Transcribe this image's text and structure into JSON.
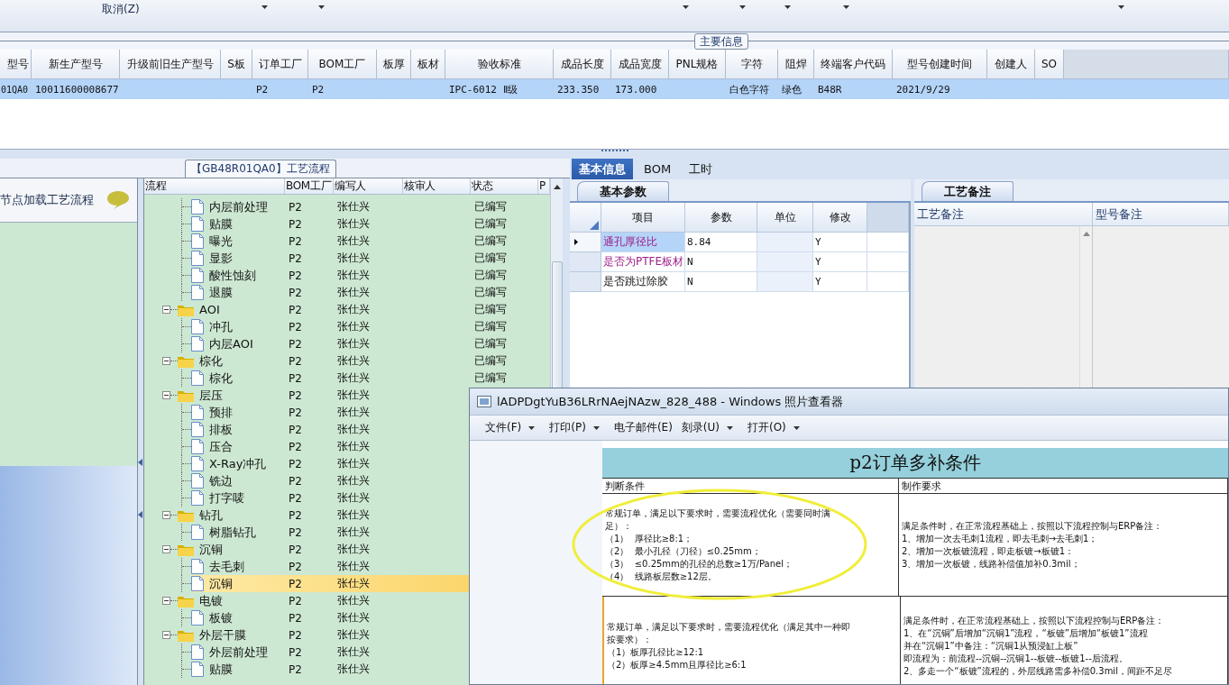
{
  "toolbar": {
    "items": [
      {
        "label": "取消(Z)"
      }
    ]
  },
  "main_info": {
    "legend": "主要信息",
    "columns": [
      "型号",
      "新生产型号",
      "升级前旧生产型号",
      "S板",
      "订单工厂",
      "BOM工厂",
      "板厚",
      "板材",
      "验收标准",
      "成品长度",
      "成品宽度",
      "PNL规格",
      "字符",
      "阻焊",
      "终端客户代码",
      "型号创建时间",
      "创建人",
      "SO"
    ],
    "rows": [
      {
        "selected": true,
        "cells": [
          "01QA0",
          "10011600008677",
          null,
          null,
          "P2",
          "P2",
          null,
          null,
          "IPC-6012 Ⅱ级",
          "233.350",
          "173.000",
          null,
          "白色字符",
          "绿色",
          "B48R",
          "2021/9/29",
          null,
          null
        ]
      }
    ]
  },
  "process_flow": {
    "legend": "【GB48R01QA0】工艺流程",
    "hint": "节点加载工艺流程",
    "columns": [
      "流程",
      "BOM工厂",
      "编写人",
      "核审人",
      "状态",
      "P"
    ],
    "tree": [
      {
        "children": [
          {
            "label": "内层前处理",
            "bom": "P2",
            "writer": "张仕兴",
            "status": "已编写",
            "selected": false
          },
          {
            "label": "贴膜",
            "bom": "P2",
            "writer": "张仕兴",
            "status": "已编写",
            "selected": false
          },
          {
            "label": "曝光",
            "bom": "P2",
            "writer": "张仕兴",
            "status": "已编写",
            "selected": false
          },
          {
            "label": "显影",
            "bom": "P2",
            "writer": "张仕兴",
            "status": "已编写",
            "selected": false
          },
          {
            "label": "酸性蚀刻",
            "bom": "P2",
            "writer": "张仕兴",
            "status": "已编写",
            "selected": false
          },
          {
            "label": "退膜",
            "bom": "P2",
            "writer": "张仕兴",
            "status": "已编写",
            "selected": false
          }
        ]
      },
      {
        "label": "AOI",
        "bom": "P2",
        "writer": "张仕兴",
        "status": "已编写",
        "selected": false,
        "expanded": true,
        "children": [
          {
            "label": "冲孔",
            "bom": "P2",
            "writer": "张仕兴",
            "status": "已编写",
            "selected": false
          },
          {
            "label": "内层AOI",
            "bom": "P2",
            "writer": "张仕兴",
            "status": "已编写",
            "selected": false
          }
        ]
      },
      {
        "label": "棕化",
        "bom": "P2",
        "writer": "张仕兴",
        "status": "已编写",
        "selected": false,
        "expanded": true,
        "children": [
          {
            "label": "棕化",
            "bom": "P2",
            "writer": "张仕兴",
            "status": "已编写",
            "selected": false
          }
        ]
      },
      {
        "label": "层压",
        "bom": "P2",
        "writer": "张仕兴",
        "selected": false,
        "expanded": true,
        "children": [
          {
            "label": "预排",
            "bom": "P2",
            "writer": "张仕兴",
            "selected": false
          },
          {
            "label": "排板",
            "bom": "P2",
            "writer": "张仕兴",
            "selected": false
          },
          {
            "label": "压合",
            "bom": "P2",
            "writer": "张仕兴",
            "selected": false
          },
          {
            "label": "X-Ray冲孔",
            "bom": "P2",
            "writer": "张仕兴",
            "selected": false
          },
          {
            "label": "铣边",
            "bom": "P2",
            "writer": "张仕兴",
            "selected": false
          },
          {
            "label": "打字唛",
            "bom": "P2",
            "writer": "张仕兴",
            "selected": false
          }
        ]
      },
      {
        "label": "钻孔",
        "bom": "P2",
        "writer": "张仕兴",
        "selected": false,
        "expanded": true,
        "children": [
          {
            "label": "树脂钻孔",
            "bom": "P2",
            "writer": "张仕兴",
            "selected": false
          }
        ]
      },
      {
        "label": "沉铜",
        "bom": "P2",
        "writer": "张仕兴",
        "selected": false,
        "expanded": true,
        "children": [
          {
            "label": "去毛刺",
            "bom": "P2",
            "writer": "张仕兴",
            "selected": false
          },
          {
            "label": "沉铜",
            "bom": "P2",
            "writer": "张仕兴",
            "selected": true
          }
        ]
      },
      {
        "label": "电镀",
        "bom": "P2",
        "writer": "张仕兴",
        "selected": false,
        "expanded": true,
        "children": [
          {
            "label": "板镀",
            "bom": "P2",
            "writer": "张仕兴",
            "selected": false
          }
        ]
      },
      {
        "label": "外层干膜",
        "bom": "P2",
        "writer": "张仕兴",
        "selected": false,
        "expanded": true,
        "children": [
          {
            "label": "外层前处理",
            "bom": "P2",
            "writer": "张仕兴",
            "selected": false
          },
          {
            "label": "贴膜",
            "bom": "P2",
            "writer": "张仕兴",
            "selected": false
          }
        ]
      }
    ]
  },
  "detail_tabs": [
    {
      "label": "基本信息",
      "selected": true
    },
    {
      "label": "BOM",
      "selected": false
    },
    {
      "label": "工时",
      "selected": false
    }
  ],
  "basic_params": {
    "tab": "基本参数",
    "columns": [
      "项目",
      "参数",
      "单位",
      "修改"
    ],
    "rows": [
      {
        "item": "通孔厚径比",
        "value": "8.84",
        "modify": "Y",
        "highlighted": true,
        "selected": true
      },
      {
        "item": "是否为PTFE板材",
        "value": "N",
        "modify": "Y",
        "highlighted": true,
        "selected": false
      },
      {
        "item": "是否跳过除胶",
        "value": "N",
        "modify": "Y",
        "highlighted": false,
        "selected": false
      }
    ]
  },
  "process_notes": {
    "tab": "工艺备注",
    "columns": [
      "工艺备注",
      "型号备注"
    ]
  },
  "photo_viewer": {
    "title": "lADPDgtYuB36LRrNAejNAzw_828_488 - Windows 照片查看器",
    "menu": [
      {
        "label": "文件(F)",
        "dropdown": true
      },
      {
        "label": "打印(P)",
        "dropdown": true
      },
      {
        "label": "电子邮件(E)",
        "dropdown": false
      },
      {
        "label": "刻录(U)",
        "dropdown": true
      },
      {
        "label": "打开(O)",
        "dropdown": true
      }
    ],
    "document": {
      "title": "p2订单多补条件",
      "columns": [
        "判断条件",
        "制作要求"
      ],
      "rows": [
        {
          "circled": true,
          "cells": [
            [
              "常规订单，满足以下要求时，需要流程优化（需要同时满",
              "足）：",
              "（1）  厚径比≥8:1；",
              "（2）  最小孔径（刀径）≤0.25mm；",
              "（3）  ≤0.25mm的孔径的总数≥1万/Panel；",
              "（4）  线路板层数≥12层。"
            ],
            [
              "满足条件时，在正常流程基础上，按照以下流程控制与ERP备注：",
              "1、增加一次去毛刺1流程，即去毛刺→去毛刺1；",
              "2、增加一次板镀流程，即走板镀→板镀1：",
              "3、增加一次板镀，线路补偿值加补0.3mil；"
            ]
          ]
        },
        {
          "circled": false,
          "cells": [
            [
              "常规订单，满足以下要求时，需要流程优化（满足其中一种即",
              "按要求）：",
              "（1）板厚孔径比≥12:1",
              "（2）板厚≥4.5mm且厚径比≥6:1"
            ],
            [
              "满足条件时，在正常流程基础上，按照以下流程控制与ERP备注：",
              "1、在“沉铜”后增加“沉铜1”流程，“板镀”后增加“板镀1”流程",
              "并在“沉铜1”中备注：“沉铜1从预浸缸上板”",
              "即流程为：前流程--沉铜--沉铜1--板镀--板镀1--后流程。",
              "2、多走一个“板镀”流程的，外层线路需多补偿0.3mil，间距不足尽"
            ]
          ]
        }
      ]
    }
  }
}
